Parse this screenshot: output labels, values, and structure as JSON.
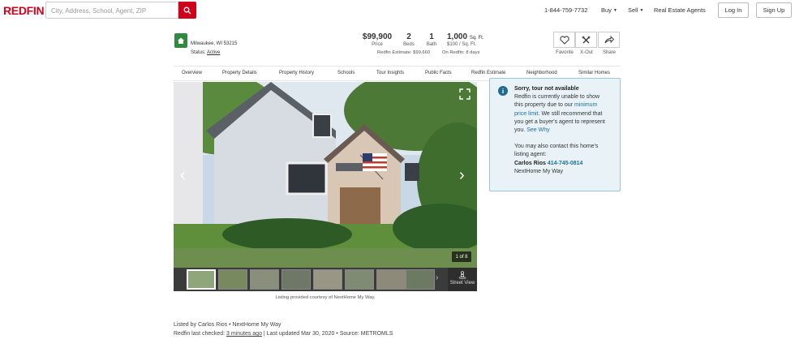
{
  "header": {
    "logo": "REDFIN",
    "search_placeholder": "City, Address, School, Agent, ZIP",
    "phone": "1-844-759-7732",
    "buy": "Buy",
    "sell": "Sell",
    "agents": "Real Estate Agents",
    "login": "Log In",
    "signup": "Sign Up"
  },
  "listing": {
    "address": "Milwaukee, WI 53215",
    "status_label": "Status:",
    "status_value": "Active",
    "price": "$99,900",
    "price_label": "Price",
    "beds": "2",
    "beds_label": "Beds",
    "baths": "1",
    "baths_label": "Bath",
    "sqft": "1,000",
    "sqft_unit": "Sq. Ft.",
    "per_sqft": "$100 / Sq. Ft.",
    "estimate": "Redfin Estimate: $99,660",
    "on_redfin": "On Redfin: 8 days"
  },
  "actions": {
    "favorite": "Favorite",
    "xout": "X-Out",
    "share": "Share"
  },
  "nav": [
    "Overview",
    "Property Details",
    "Property History",
    "Schools",
    "Tour Insights",
    "Public Facts",
    "Redfin Estimate",
    "Neighborhood",
    "Similar Homes"
  ],
  "photo": {
    "counter": "1 of 8",
    "street_view": "Street View",
    "credit": "Listing provided courtesy of NextHome My Way."
  },
  "notice": {
    "title": "Sorry, tour not available",
    "line1": "Redfin is currently unable to show",
    "line2": "this property due to our ",
    "link1a": "minimum",
    "link1b": "price limit",
    "line3": ". We still recommend that",
    "line4": "you get a buyer's agent to represent",
    "line5": "you. ",
    "link2": "See Why",
    "contact1": "You may also contact this home's",
    "contact2": "listing agent:",
    "agent_name": "Carlos Rios",
    "agent_phone": "414-745-0814",
    "agent_company": "NextHome My Way"
  },
  "footer": {
    "listed_by": "Listed by Carlos Rios •  NextHome My Way",
    "checked_prefix": "Redfin last checked: ",
    "checked_value": "3 minutes ago",
    "checked_suffix": " | Last updated Mar 30, 2020 • Source:  METROMLS"
  },
  "colors": {
    "brand": "#d0021b",
    "house_badge": "#2f8a3e",
    "notice_bg": "#e9f3f7",
    "link": "#1c6ea4"
  }
}
